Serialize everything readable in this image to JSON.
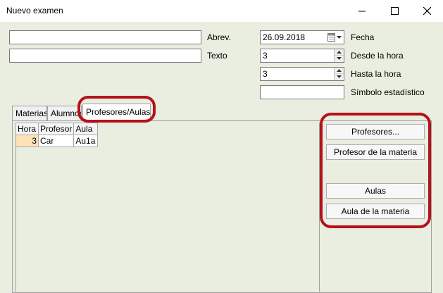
{
  "window": {
    "title": "Nuevo examen"
  },
  "form": {
    "abrev": {
      "label": "Abrev.",
      "value": ""
    },
    "texto": {
      "label": "Texto",
      "value": ""
    },
    "fecha": {
      "label": "Fecha",
      "value": "26.09.2018"
    },
    "desde_hora": {
      "label": "Desde la hora",
      "value": "3"
    },
    "hasta_hora": {
      "label": "Hasta la hora",
      "value": "3"
    },
    "simbolo": {
      "label": "Símbolo estadístico",
      "value": ""
    }
  },
  "tabs": [
    {
      "label": "Materias",
      "active": false
    },
    {
      "label": "Alumnos",
      "active": false
    },
    {
      "label": "Profesores/Aulas",
      "active": true
    }
  ],
  "grid": {
    "columns": [
      "Hora",
      "Profesor",
      "Aula"
    ],
    "rows": [
      {
        "hora": "3",
        "profesor": "Car",
        "aula": "Au1a"
      }
    ]
  },
  "buttons": {
    "profesores": "Profesores...",
    "profesor_materia": "Profesor de la materia",
    "aulas": "Aulas",
    "aula_materia": "Aula de la materia"
  },
  "icons": {
    "minimize": "minimize-icon",
    "maximize": "maximize-icon",
    "close": "close-icon",
    "calendar": "calendar-icon",
    "spin_up": "arrow-up-icon",
    "spin_down": "arrow-down-icon"
  },
  "colors": {
    "annotation": "#b5121b",
    "window_bg": "#e9eee0",
    "hora_cell": "#fde2b8"
  }
}
